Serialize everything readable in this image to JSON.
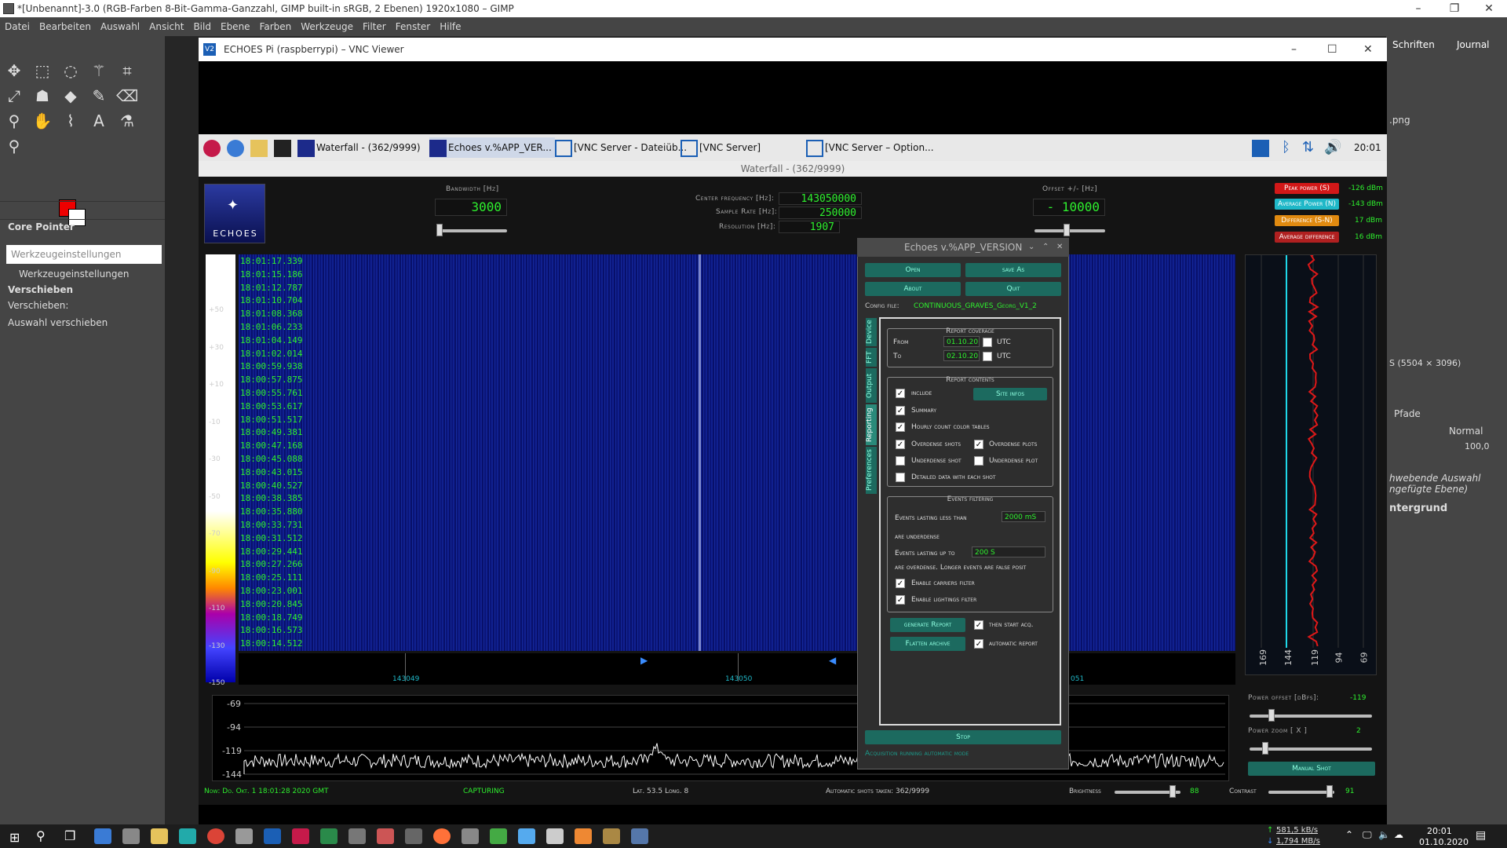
{
  "gimp": {
    "title": "*[Unbenannt]-3.0 (RGB-Farben 8-Bit-Gamma-Ganzzahl, GIMP built-in sRGB, 2 Ebenen) 1920x1080 – GIMP",
    "menu": [
      "Datei",
      "Bearbeiten",
      "Auswahl",
      "Ansicht",
      "Bild",
      "Ebene",
      "Farben",
      "Werkzeuge",
      "Filter",
      "Fenster",
      "Hilfe"
    ],
    "dock_title": "Core Pointer",
    "tool_options_placeholder": "Werkzeugeinstellungen",
    "tool_options_tab": "Werkzeugeinstellungen",
    "tool_name": "Verschieben",
    "move_label": "Verschieben:",
    "move_mode": "Auswahl verschieben",
    "right_tabs": [
      "Schriften",
      "Journal"
    ],
    "right_file": ".png",
    "right_size": "S (5504 × 3096)",
    "paths_tab": "Pfade",
    "layer_mode": "Normal",
    "opacity": "100,0",
    "layers": [
      "hwebende Auswahl",
      "ngefügte Ebene)",
      "ntergrund"
    ]
  },
  "vnc": {
    "title": "ECHOES Pi (raspberrypi) – VNC Viewer",
    "taskbar_items": [
      "Waterfall - (362/9999)",
      "Echoes v.%APP_VER...",
      "[VNC Server - Dateiüb...",
      "[VNC Server]",
      "[VNC Server – Option..."
    ],
    "clock": "20:01",
    "subwindow_title": "Waterfall - (362/9999)"
  },
  "echoes": {
    "logo_text": "ECHOES",
    "bandwidth_label": "Bandwidth [Hz]",
    "bandwidth_value": "3000",
    "center_freq_label": "Center frequency [Hz]:",
    "center_freq_value": "143050000",
    "sample_rate_label": "Sample Rate [Hz]:",
    "sample_rate_value": "250000",
    "resolution_label": "Resolution [Hz]:",
    "resolution_value": "1907",
    "offset_label": "Offset +/- [Hz]",
    "offset_value": "- 10000",
    "peak_power_label": "Peak power (S)",
    "peak_power_value": "-126 dBm",
    "avg_power_label": "Average Power (N)",
    "avg_power_value": "-143 dBm",
    "difference_label": "Difference (S-N)",
    "difference_value": "17 dBm",
    "avg_diff_label": "Average difference",
    "avg_diff_value": "16 dBm",
    "timestamps": [
      "18:01:17.339",
      "18:01:15.186",
      "18:01:12.787",
      "18:01:10.704",
      "18:01:08.368",
      "18:01:06.233",
      "18:01:04.149",
      "18:01:02.014",
      "18:00:59.938",
      "18:00:57.875",
      "18:00:55.761",
      "18:00:53.617",
      "18:00:51.517",
      "18:00:49.381",
      "18:00:47.168",
      "18:00:45.088",
      "18:00:43.015",
      "18:00:40.527",
      "18:00:38.385",
      "18:00:35.880",
      "18:00:33.731",
      "18:00:31.512",
      "18:00:29.441",
      "18:00:27.266",
      "18:00:25.111",
      "18:00:23.001",
      "18:00:20.845",
      "18:00:18.749",
      "18:00:16.573",
      "18:00:14.512"
    ],
    "db_scale": [
      "+50",
      "+30",
      "+10",
      "-10",
      "-30",
      "-50",
      "-70",
      "-90",
      "-110",
      "-130",
      "-150"
    ],
    "freq_ticks": [
      "143049",
      "143050",
      "051"
    ],
    "spectrum_y": [
      "-69",
      "-94",
      "-119",
      "-144"
    ],
    "power_ticks": [
      "169",
      "144",
      "119",
      "94",
      "69"
    ],
    "power_offset_label": "Power offset [dBfs]:",
    "power_offset_value": "-119",
    "power_zoom_label": "Power zoom [ X ]",
    "power_zoom_value": "2",
    "manual_shot": "Manual Shot",
    "status_now": "Now: Do. Okt. 1 18:01:28 2020 GMT",
    "status_capturing": "CAPTURING",
    "status_lat": "Lat. 53.5 Long. 8",
    "status_shots": "Automatic shots taken: 362/9999",
    "brightness_label": "Brightness",
    "brightness_value": "88",
    "contrast_label": "Contrast",
    "contrast_value": "91"
  },
  "dialog": {
    "title": "Echoes v.%APP_VERSION",
    "open": "Open",
    "save_as": "save As",
    "about": "About",
    "quit": "Quit",
    "config_label": "Config file:",
    "config_value": "CONTINUOUS_GRAVES_Georg_V1_2",
    "tabs": [
      "Device",
      "FFT",
      "Output",
      "Reporting",
      "Preferences"
    ],
    "coverage_title": "Report coverage",
    "from_label": "From",
    "from_value": "01.10.20",
    "to_label": "To",
    "to_value": "02.10.20",
    "utc": "UTC",
    "contents_title": "Report contents",
    "include": "include",
    "site_infos": "Site infos",
    "summary": "Summary",
    "hourly": "Hourly count color tables",
    "overdense_shots": "Overdense shots",
    "overdense_plots": "Overdense plots",
    "underdense_shot": "Underdense shot",
    "underdense_plot": "Underdense plot",
    "detailed": "Detailed data with each shot",
    "filtering_title": "Events filtering",
    "ev_less": "Events lasting less than",
    "ev_less_value": "2000 mS",
    "are_underdense": "are underdense",
    "ev_upto": "Events lasting up to",
    "ev_upto_value": "200 S",
    "are_overdense": "are overdense. Longer events are false posit",
    "carriers": "Enable carriers filter",
    "lightings": "Enable lightings filter",
    "generate": "generate Report",
    "then_start": "then start acq.",
    "flatten": "Flatten archive",
    "auto_report": "automatic report",
    "stop": "Stop",
    "status": "Acquisition running automatic mode"
  },
  "windows": {
    "net_up": "581,5 kB/s",
    "net_down": "1,794 MB/s",
    "time": "20:01",
    "date": "01.10.2020"
  }
}
